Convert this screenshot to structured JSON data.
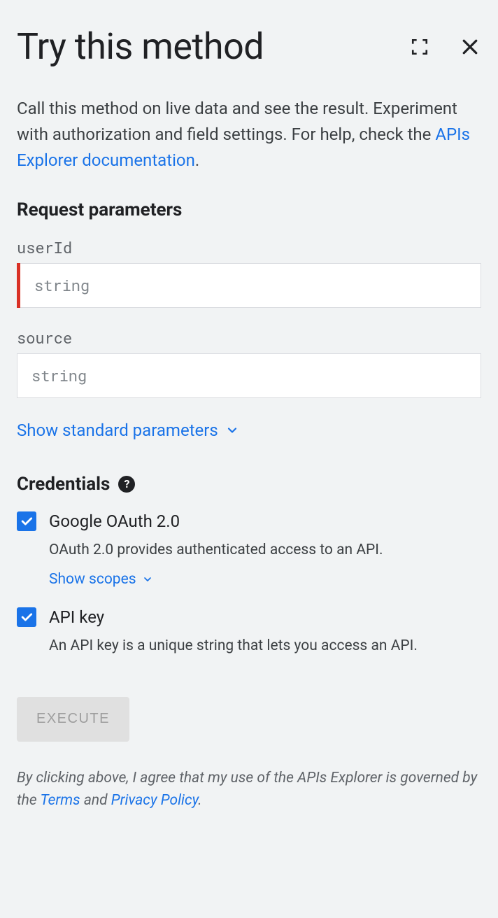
{
  "header": {
    "title": "Try this method"
  },
  "description": {
    "text_before_link": "Call this method on live data and see the result. Experiment with authorization and field settings. For help, check the ",
    "link_text": "APIs Explorer documentation",
    "text_after_link": "."
  },
  "request_parameters": {
    "heading": "Request parameters",
    "params": [
      {
        "name": "userId",
        "placeholder": "string",
        "required": true
      },
      {
        "name": "source",
        "placeholder": "string",
        "required": false
      }
    ],
    "show_standard_label": "Show standard parameters"
  },
  "credentials": {
    "heading": "Credentials",
    "items": [
      {
        "label": "Google OAuth 2.0",
        "checked": true,
        "description": "OAuth 2.0 provides authenticated access to an API.",
        "scopes_link": "Show scopes"
      },
      {
        "label": "API key",
        "checked": true,
        "description": "An API key is a unique string that lets you access an API."
      }
    ]
  },
  "execute_label": "EXECUTE",
  "legal": {
    "before_terms": "By clicking above, I agree that my use of the APIs Explorer is governed by the ",
    "terms": "Terms",
    "between": " and ",
    "privacy": "Privacy Policy",
    "after": "."
  }
}
